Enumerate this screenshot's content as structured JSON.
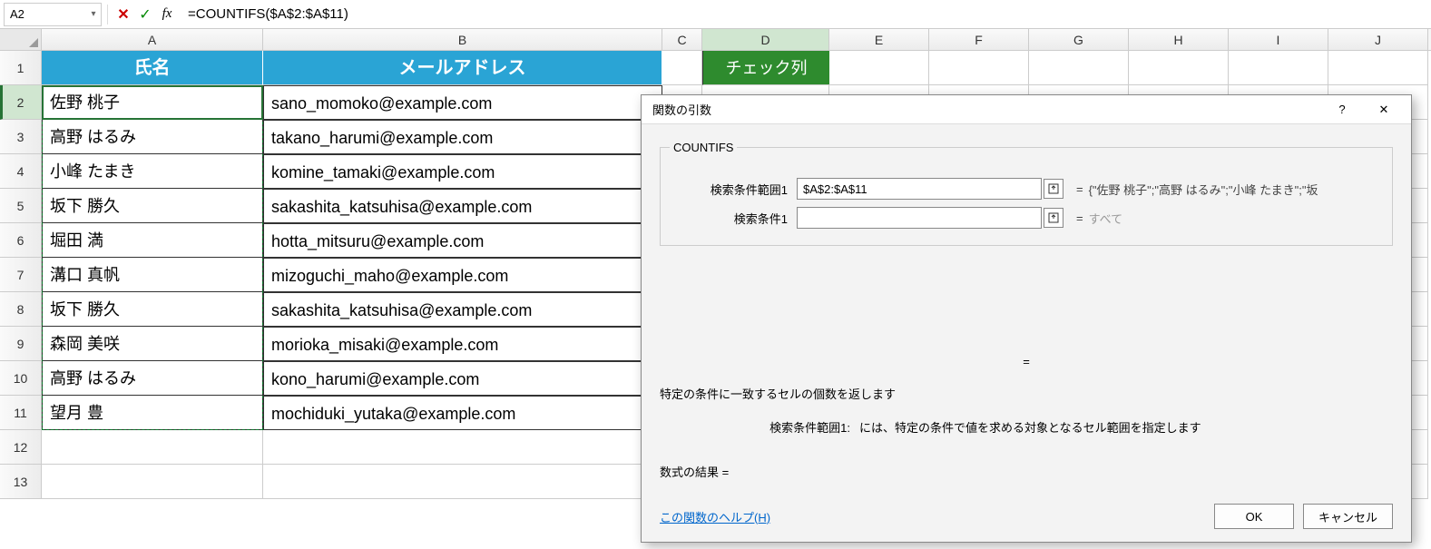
{
  "namebox": "A2",
  "formula": "=COUNTIFS($A$2:$A$11)",
  "columns": [
    "A",
    "B",
    "C",
    "D",
    "E",
    "F",
    "G",
    "H",
    "I",
    "J"
  ],
  "row_numbers": [
    1,
    2,
    3,
    4,
    5,
    6,
    7,
    8,
    9,
    10,
    11,
    12,
    13
  ],
  "headers": {
    "a": "氏名",
    "b": "メールアドレス",
    "d": "チェック列"
  },
  "table": [
    {
      "name": "佐野 桃子",
      "mail": "sano_momoko@example.com"
    },
    {
      "name": "高野 はるみ",
      "mail": "takano_harumi@example.com"
    },
    {
      "name": "小峰 たまき",
      "mail": "komine_tamaki@example.com"
    },
    {
      "name": "坂下 勝久",
      "mail": "sakashita_katsuhisa@example.com"
    },
    {
      "name": "堀田 満",
      "mail": "hotta_mitsuru@example.com"
    },
    {
      "name": "溝口 真帆",
      "mail": "mizoguchi_maho@example.com"
    },
    {
      "name": "坂下 勝久",
      "mail": "sakashita_katsuhisa@example.com"
    },
    {
      "name": "森岡 美咲",
      "mail": "morioka_misaki@example.com"
    },
    {
      "name": "高野 はるみ",
      "mail": "kono_harumi@example.com"
    },
    {
      "name": "望月 豊",
      "mail": "mochiduki_yutaka@example.com"
    }
  ],
  "dialog": {
    "title": "関数の引数",
    "func": "COUNTIFS",
    "arg1_label": "検索条件範囲1",
    "arg1_value": "$A$2:$A$11",
    "arg1_eval": "{\"佐野 桃子\";\"高野 はるみ\";\"小峰 たまき\";\"坂",
    "arg2_label": "検索条件1",
    "arg2_value": "",
    "arg2_eval": "すべて",
    "eq": "=",
    "center_eq": "=",
    "desc1": "特定の条件に一致するセルの個数を返します",
    "arg_desc_label": "検索条件範囲1:",
    "arg_desc_text": "には、特定の条件で値を求める対象となるセル範囲を指定します",
    "result_label": "数式の結果 =",
    "help": "この関数のヘルプ(H)",
    "ok": "OK",
    "cancel": "キャンセル",
    "help_icon": "?",
    "close_icon": "✕"
  }
}
